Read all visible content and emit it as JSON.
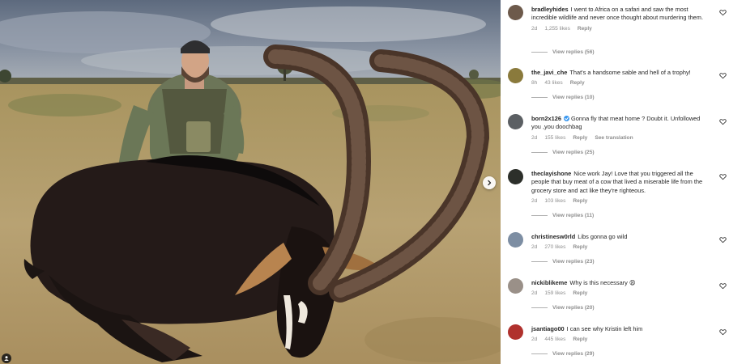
{
  "post": {
    "photo_alt": "Hunter kneeling beside a sable antelope",
    "next_icon": "chevron-right-icon",
    "tag_icon": "user-tag-icon"
  },
  "colors": {
    "username": "#262626",
    "meta": "#8e8e8e",
    "verified": "#3897f0",
    "like_outline": "#262626"
  },
  "comments": [
    {
      "username": "bradleyhides",
      "text": "I went to Africa on a safari and saw the most incredible wildlife and never once thought about murdering them.",
      "time": "2d",
      "likes": "1,255 likes",
      "reply": "Reply",
      "view_replies": "View replies (56)",
      "avatar_color": "#6d5a4b"
    },
    {
      "username": "the_javi_che",
      "text": "That's a handsome sable and hell of a trophy!",
      "time": "8h",
      "likes": "43 likes",
      "reply": "Reply",
      "view_replies": "View replies (10)",
      "avatar_color": "#8a7a3c"
    },
    {
      "username": "born2x126",
      "verified": true,
      "text": "Gonna fly that meat home ? Doubt it. Unfollowed you ,you doochbag",
      "time": "2d",
      "likes": "155 likes",
      "reply": "Reply",
      "translate": "See translation",
      "view_replies": "View replies (25)",
      "avatar_color": "#5b5f63"
    },
    {
      "username": "theclayishone",
      "text": "Nice work Jay! Love that you triggered all the people that buy meat of a cow that lived a miserable life from the grocery store and act like they're righteous.",
      "time": "2d",
      "likes": "103 likes",
      "reply": "Reply",
      "view_replies": "View replies (11)",
      "avatar_color": "#2c2f2a"
    },
    {
      "username": "christinesw0rld",
      "text": "Libs gonna go wild",
      "time": "2d",
      "likes": "270 likes",
      "reply": "Reply",
      "view_replies": "View replies (23)",
      "avatar_color": "#7d8ea3"
    },
    {
      "username": "nickiblikeme",
      "text": "Why is this necessary 😩",
      "time": "2d",
      "likes": "159 likes",
      "reply": "Reply",
      "view_replies": "View replies (20)",
      "avatar_color": "#9a9088"
    },
    {
      "username": "jsantiago00",
      "text": "I can see why Kristin left him",
      "time": "2d",
      "likes": "445 likes",
      "reply": "Reply",
      "view_replies": "View replies (29)",
      "avatar_color": "#b0312d"
    }
  ]
}
